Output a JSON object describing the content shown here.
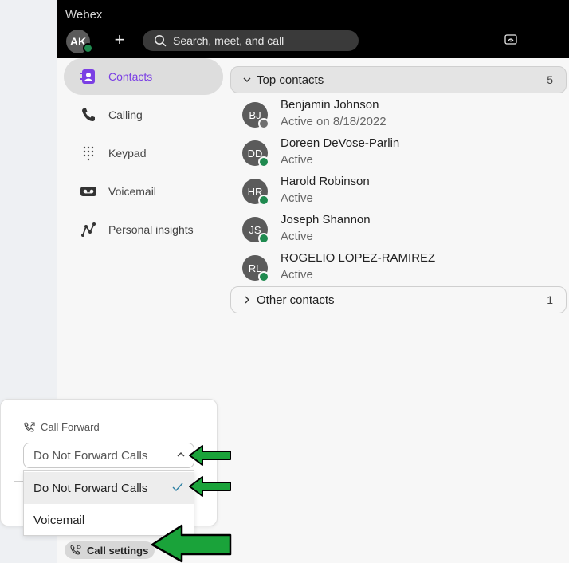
{
  "app": {
    "title": "Webex"
  },
  "header": {
    "user_initials": "AK",
    "new_label": "+",
    "search_placeholder": "Search, meet, and call"
  },
  "sidebar": {
    "items": [
      {
        "label": "Contacts",
        "icon": "contacts-icon",
        "active": true
      },
      {
        "label": "Calling",
        "icon": "phone-icon",
        "active": false
      },
      {
        "label": "Keypad",
        "icon": "keypad-icon",
        "active": false
      },
      {
        "label": "Voicemail",
        "icon": "voicemail-icon",
        "active": false
      },
      {
        "label": "Personal insights",
        "icon": "insights-icon",
        "active": false
      }
    ]
  },
  "contacts": {
    "top": {
      "title": "Top contacts",
      "count": "5",
      "people": [
        {
          "initials": "BJ",
          "name": "Benjamin Johnson",
          "status": "Active on 8/18/2022",
          "presence": "away"
        },
        {
          "initials": "DD",
          "name": "Doreen DeVose-Parlin",
          "status": "Active",
          "presence": "active"
        },
        {
          "initials": "HR",
          "name": "Harold Robinson",
          "status": "Active",
          "presence": "active"
        },
        {
          "initials": "JS",
          "name": "Joseph Shannon",
          "status": "Active",
          "presence": "active"
        },
        {
          "initials": "RL",
          "name": "ROGELIO LOPEZ-RAMIREZ",
          "status": "Active",
          "presence": "active"
        }
      ]
    },
    "other": {
      "title": "Other contacts",
      "count": "1"
    }
  },
  "call_forward": {
    "title": "Call Forward",
    "selected": "Do Not Forward Calls",
    "options": [
      "Do Not Forward Calls",
      "Voicemail"
    ]
  },
  "call_settings": {
    "label": "Call settings"
  },
  "colors": {
    "accent": "#7b3fe4",
    "presence_active": "#1f8a4f",
    "annotation_arrow": "#1aa33a"
  }
}
